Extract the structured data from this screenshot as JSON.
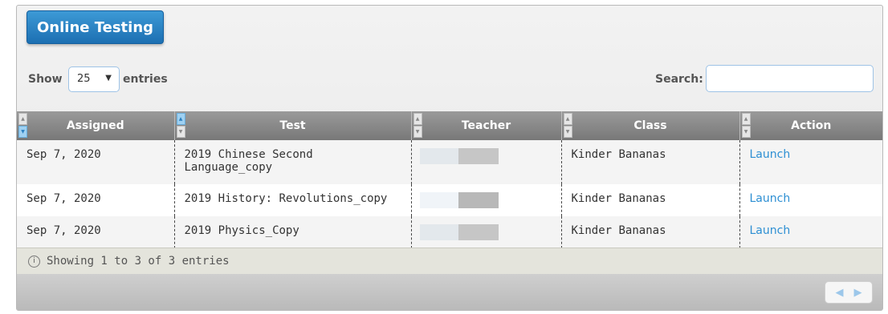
{
  "panel": {
    "title": "Online Testing"
  },
  "controls": {
    "show_label": "Show",
    "page_length": "25",
    "entries_label": "entries",
    "search_label": "Search:",
    "search_value": ""
  },
  "table": {
    "columns": [
      "Assigned",
      "Test",
      "Teacher",
      "Class",
      "Action"
    ],
    "rows": [
      {
        "assigned": "Sep 7, 2020",
        "test": "2019 Chinese Second Language_copy",
        "teacher": "",
        "class": "Kinder Bananas",
        "action": "Launch"
      },
      {
        "assigned": "Sep 7, 2020",
        "test": "2019 History: Revolutions_copy",
        "teacher": "",
        "class": "Kinder Bananas",
        "action": "Launch"
      },
      {
        "assigned": "Sep 7, 2020",
        "test": "2019 Physics_Copy",
        "teacher": "",
        "class": "Kinder Bananas",
        "action": "Launch"
      }
    ]
  },
  "info": {
    "text": "Showing 1 to 3 of 3 entries",
    "icon": "info-icon"
  },
  "pager": {
    "prev_icon": "previous-arrow-icon",
    "next_icon": "next-arrow-icon"
  },
  "colors": {
    "title_tab": "#1c6fb2",
    "header_bg": "#8a8a8a",
    "link": "#2d8fd3"
  }
}
